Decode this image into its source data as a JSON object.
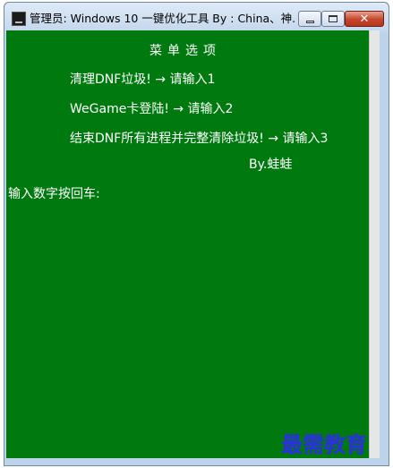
{
  "window": {
    "title": "管理员:  Windows 10 一键优化工具 By : China、神...",
    "app_icon": "console-app-icon",
    "controls": {
      "minimize": "minimize-icon",
      "maximize": "maximize-icon",
      "close": "✕"
    }
  },
  "console": {
    "background_color": "#007a0f",
    "text_color": "#ffffff",
    "menu_title": "菜单选项",
    "options": [
      "清理DNF垃圾! → 请输入1",
      "WeGame卡登陆! → 请输入2",
      "结束DNF所有进程并完整清除垃圾!  → 请输入3"
    ],
    "byline": "By.蛙蛙",
    "prompt": "输入数字按回车:"
  },
  "watermark": "最需教育"
}
